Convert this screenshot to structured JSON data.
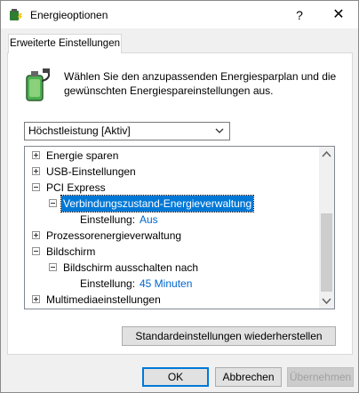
{
  "window": {
    "title": "Energieoptionen",
    "help_glyph": "?",
    "close_glyph": "✕",
    "app_icon": "power-options-icon"
  },
  "tab": {
    "label": "Erweiterte Einstellungen"
  },
  "description": "Wählen Sie den anzupassenden Energiesparplan und die gewünschten Energiespareinstellungen aus.",
  "plan_select": {
    "value": "Höchstleistung [Aktiv]"
  },
  "tree": {
    "items": [
      {
        "label": "Energie sparen",
        "expander": "plus"
      },
      {
        "label": "USB-Einstellungen",
        "expander": "plus"
      },
      {
        "label": "PCI Express",
        "expander": "minus"
      },
      {
        "label": "Verbindungszustand-Energieverwaltung",
        "expander": "minus",
        "selected": true
      },
      {
        "label": "Einstellung:",
        "value": "Aus"
      },
      {
        "label": "Prozessorenergieverwaltung",
        "expander": "plus"
      },
      {
        "label": "Bildschirm",
        "expander": "minus"
      },
      {
        "label": "Bildschirm ausschalten nach",
        "expander": "minus"
      },
      {
        "label": "Einstellung:",
        "value": "45 Minuten"
      },
      {
        "label": "Multimediaeinstellungen",
        "expander": "plus"
      }
    ]
  },
  "buttons": {
    "restore": "Standardeinstellungen wiederherstellen",
    "ok": "OK",
    "cancel": "Abbrechen",
    "apply": "Übernehmen"
  },
  "colors": {
    "selection": "#0078d7",
    "link_value": "#0066cc"
  }
}
